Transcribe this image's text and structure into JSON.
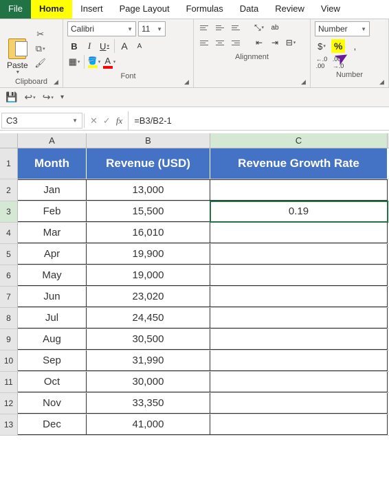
{
  "tabs": {
    "file": "File",
    "home": "Home",
    "insert": "Insert",
    "page_layout": "Page Layout",
    "formulas": "Formulas",
    "data": "Data",
    "review": "Review",
    "view": "View"
  },
  "ribbon": {
    "clipboard": {
      "label": "Clipboard",
      "paste": "Paste"
    },
    "font": {
      "label": "Font",
      "name": "Calibri",
      "size": "11",
      "bold": "B",
      "italic": "I",
      "underline": "U",
      "fill_letter": "A",
      "font_letter": "A",
      "grow": "A",
      "shrink": "A"
    },
    "alignment": {
      "label": "Alignment",
      "wrap": "ab"
    },
    "number": {
      "label": "Number",
      "format": "Number",
      "currency": "$",
      "percent": "%",
      "comma": ",",
      "inc": ".00",
      "dec": ".00"
    }
  },
  "name_box": "C3",
  "formula": "=B3/B2-1",
  "columns": {
    "A": "A",
    "B": "B",
    "C": "C"
  },
  "headers": {
    "month": "Month",
    "revenue": "Revenue (USD)",
    "growth": "Revenue Growth Rate"
  },
  "rows": [
    {
      "n": "1"
    },
    {
      "n": "2",
      "month": "Jan",
      "rev": "13,000",
      "growth": ""
    },
    {
      "n": "3",
      "month": "Feb",
      "rev": "15,500",
      "growth": "0.19"
    },
    {
      "n": "4",
      "month": "Mar",
      "rev": "16,010",
      "growth": ""
    },
    {
      "n": "5",
      "month": "Apr",
      "rev": "19,900",
      "growth": ""
    },
    {
      "n": "6",
      "month": "May",
      "rev": "19,000",
      "growth": ""
    },
    {
      "n": "7",
      "month": "Jun",
      "rev": "23,020",
      "growth": ""
    },
    {
      "n": "8",
      "month": "Jul",
      "rev": "24,450",
      "growth": ""
    },
    {
      "n": "9",
      "month": "Aug",
      "rev": "30,500",
      "growth": ""
    },
    {
      "n": "10",
      "month": "Sep",
      "rev": "31,990",
      "growth": ""
    },
    {
      "n": "11",
      "month": "Oct",
      "rev": "30,000",
      "growth": ""
    },
    {
      "n": "12",
      "month": "Nov",
      "rev": "33,350",
      "growth": ""
    },
    {
      "n": "13",
      "month": "Dec",
      "rev": "41,000",
      "growth": ""
    }
  ]
}
